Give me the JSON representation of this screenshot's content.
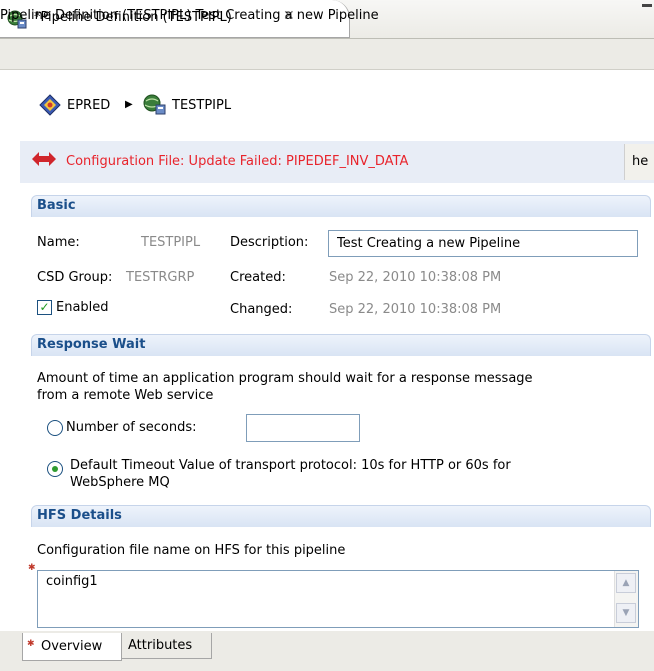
{
  "editor": {
    "tab_title": "*Pipeline Definition (TESTPIPL)",
    "subtitle": "Pipeline Definition (TESTPIPL) Test Creating a new Pipeline"
  },
  "breadcrumb": {
    "items": [
      "EPRED",
      "TESTPIPL"
    ]
  },
  "message": {
    "text": "Configuration File: Update Failed: PIPEDEF_INV_DATA",
    "right_label": "he",
    "color": "#e8242c"
  },
  "basic": {
    "title": "Basic",
    "name_label": "Name:",
    "name_value": "TESTPIPL",
    "description_label": "Description:",
    "description_value": "Test Creating a new Pipeline",
    "csd_group_label": "CSD Group:",
    "csd_group_value": "TESTRGRP",
    "created_label": "Created:",
    "created_value": "Sep 22, 2010 10:38:08 PM",
    "enabled_label": "Enabled",
    "enabled_checked": true,
    "changed_label": "Changed:",
    "changed_value": "Sep 22, 2010 10:38:08 PM"
  },
  "response_wait": {
    "title": "Response Wait",
    "description_line1": "Amount of time an application program should wait for a response message",
    "description_line2": "from a remote Web service",
    "option_seconds_label": "Number of seconds:",
    "seconds_value": "",
    "option_default_line1": "Default Timeout Value of transport protocol: 10s for HTTP or 60s for",
    "option_default_line2": "WebSphere MQ",
    "selected_option": "default"
  },
  "hfs": {
    "title": "HFS Details",
    "description": "Configuration file name on HFS for this pipeline",
    "config_file_value": "coinfig1"
  },
  "bottom_tabs": {
    "overview": "Overview",
    "attributes": "Attributes"
  },
  "colors": {
    "section_title": "#1b4f8a",
    "error_text": "#e8242c",
    "readonly_text": "#8a8a8a"
  },
  "icons": [
    "pipeline-globe-icon",
    "close-icon",
    "minimize-icon",
    "region-icon",
    "breadcrumb-arrow-icon",
    "error-arrow-icon",
    "checkmark-icon",
    "required-marker-icon",
    "scroll-up-icon",
    "scroll-down-icon"
  ]
}
